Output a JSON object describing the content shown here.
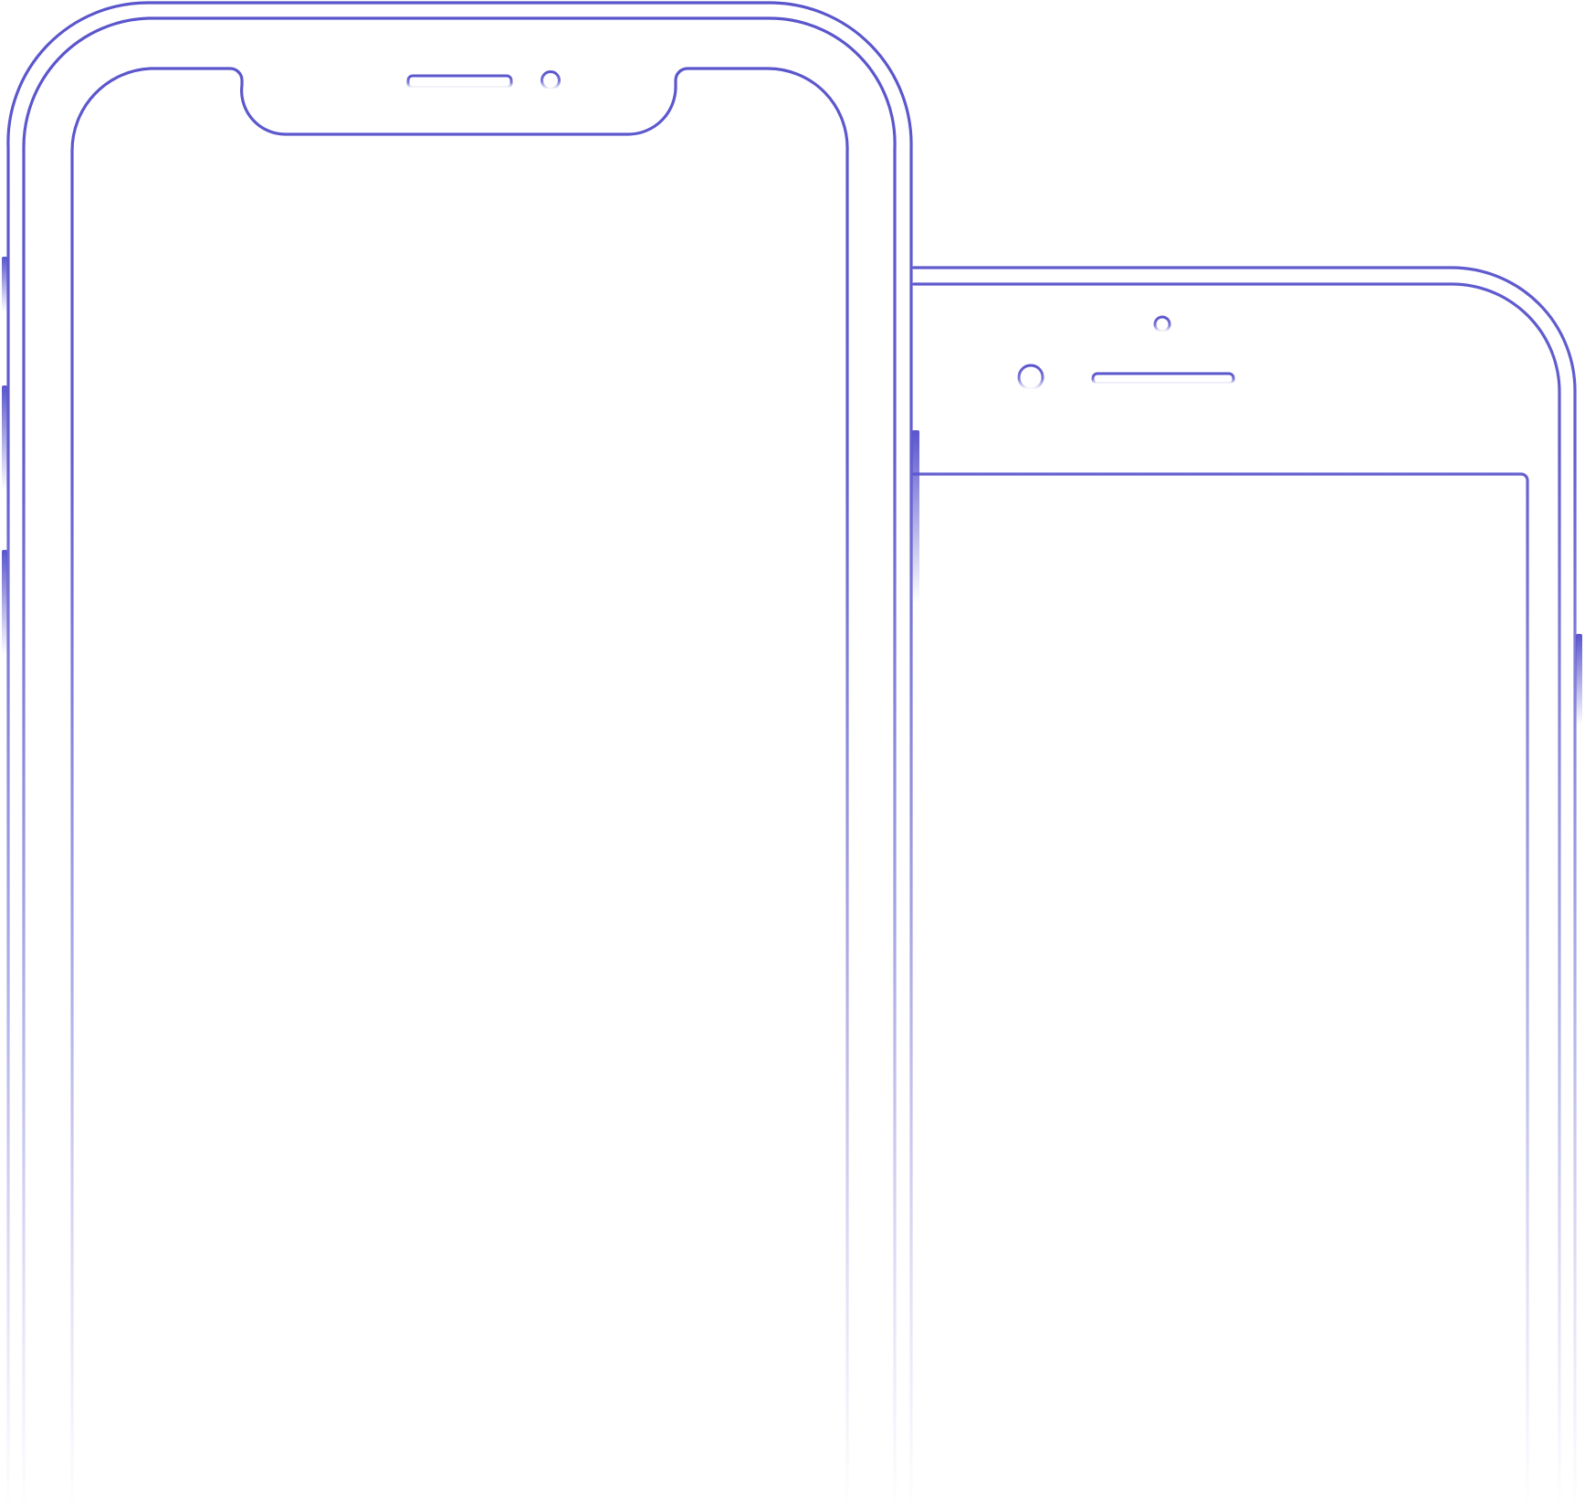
{
  "style": {
    "stroke_color": "#5a55cc",
    "background_color": "#ffffff"
  },
  "devices": [
    {
      "name": "phone-with-notch",
      "icons": [
        "speaker-grille-icon",
        "front-camera-icon",
        "side-button-icon"
      ]
    },
    {
      "name": "phone-with-bezel",
      "icons": [
        "proximity-sensor-icon",
        "front-camera-icon",
        "speaker-grille-icon",
        "side-button-icon"
      ]
    }
  ]
}
